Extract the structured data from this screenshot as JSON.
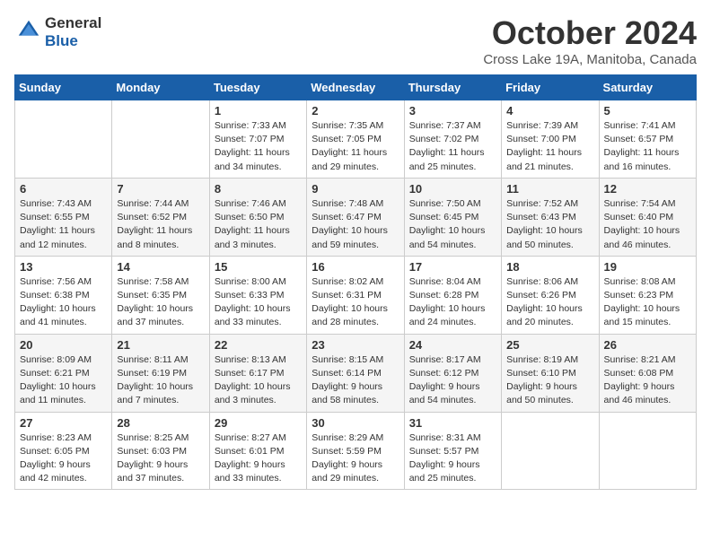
{
  "logo": {
    "general": "General",
    "blue": "Blue"
  },
  "header": {
    "month": "October 2024",
    "location": "Cross Lake 19A, Manitoba, Canada"
  },
  "weekdays": [
    "Sunday",
    "Monday",
    "Tuesday",
    "Wednesday",
    "Thursday",
    "Friday",
    "Saturday"
  ],
  "weeks": [
    [
      {
        "day": "",
        "info": ""
      },
      {
        "day": "",
        "info": ""
      },
      {
        "day": "1",
        "info": "Sunrise: 7:33 AM\nSunset: 7:07 PM\nDaylight: 11 hours\nand 34 minutes."
      },
      {
        "day": "2",
        "info": "Sunrise: 7:35 AM\nSunset: 7:05 PM\nDaylight: 11 hours\nand 29 minutes."
      },
      {
        "day": "3",
        "info": "Sunrise: 7:37 AM\nSunset: 7:02 PM\nDaylight: 11 hours\nand 25 minutes."
      },
      {
        "day": "4",
        "info": "Sunrise: 7:39 AM\nSunset: 7:00 PM\nDaylight: 11 hours\nand 21 minutes."
      },
      {
        "day": "5",
        "info": "Sunrise: 7:41 AM\nSunset: 6:57 PM\nDaylight: 11 hours\nand 16 minutes."
      }
    ],
    [
      {
        "day": "6",
        "info": "Sunrise: 7:43 AM\nSunset: 6:55 PM\nDaylight: 11 hours\nand 12 minutes."
      },
      {
        "day": "7",
        "info": "Sunrise: 7:44 AM\nSunset: 6:52 PM\nDaylight: 11 hours\nand 8 minutes."
      },
      {
        "day": "8",
        "info": "Sunrise: 7:46 AM\nSunset: 6:50 PM\nDaylight: 11 hours\nand 3 minutes."
      },
      {
        "day": "9",
        "info": "Sunrise: 7:48 AM\nSunset: 6:47 PM\nDaylight: 10 hours\nand 59 minutes."
      },
      {
        "day": "10",
        "info": "Sunrise: 7:50 AM\nSunset: 6:45 PM\nDaylight: 10 hours\nand 54 minutes."
      },
      {
        "day": "11",
        "info": "Sunrise: 7:52 AM\nSunset: 6:43 PM\nDaylight: 10 hours\nand 50 minutes."
      },
      {
        "day": "12",
        "info": "Sunrise: 7:54 AM\nSunset: 6:40 PM\nDaylight: 10 hours\nand 46 minutes."
      }
    ],
    [
      {
        "day": "13",
        "info": "Sunrise: 7:56 AM\nSunset: 6:38 PM\nDaylight: 10 hours\nand 41 minutes."
      },
      {
        "day": "14",
        "info": "Sunrise: 7:58 AM\nSunset: 6:35 PM\nDaylight: 10 hours\nand 37 minutes."
      },
      {
        "day": "15",
        "info": "Sunrise: 8:00 AM\nSunset: 6:33 PM\nDaylight: 10 hours\nand 33 minutes."
      },
      {
        "day": "16",
        "info": "Sunrise: 8:02 AM\nSunset: 6:31 PM\nDaylight: 10 hours\nand 28 minutes."
      },
      {
        "day": "17",
        "info": "Sunrise: 8:04 AM\nSunset: 6:28 PM\nDaylight: 10 hours\nand 24 minutes."
      },
      {
        "day": "18",
        "info": "Sunrise: 8:06 AM\nSunset: 6:26 PM\nDaylight: 10 hours\nand 20 minutes."
      },
      {
        "day": "19",
        "info": "Sunrise: 8:08 AM\nSunset: 6:23 PM\nDaylight: 10 hours\nand 15 minutes."
      }
    ],
    [
      {
        "day": "20",
        "info": "Sunrise: 8:09 AM\nSunset: 6:21 PM\nDaylight: 10 hours\nand 11 minutes."
      },
      {
        "day": "21",
        "info": "Sunrise: 8:11 AM\nSunset: 6:19 PM\nDaylight: 10 hours\nand 7 minutes."
      },
      {
        "day": "22",
        "info": "Sunrise: 8:13 AM\nSunset: 6:17 PM\nDaylight: 10 hours\nand 3 minutes."
      },
      {
        "day": "23",
        "info": "Sunrise: 8:15 AM\nSunset: 6:14 PM\nDaylight: 9 hours\nand 58 minutes."
      },
      {
        "day": "24",
        "info": "Sunrise: 8:17 AM\nSunset: 6:12 PM\nDaylight: 9 hours\nand 54 minutes."
      },
      {
        "day": "25",
        "info": "Sunrise: 8:19 AM\nSunset: 6:10 PM\nDaylight: 9 hours\nand 50 minutes."
      },
      {
        "day": "26",
        "info": "Sunrise: 8:21 AM\nSunset: 6:08 PM\nDaylight: 9 hours\nand 46 minutes."
      }
    ],
    [
      {
        "day": "27",
        "info": "Sunrise: 8:23 AM\nSunset: 6:05 PM\nDaylight: 9 hours\nand 42 minutes."
      },
      {
        "day": "28",
        "info": "Sunrise: 8:25 AM\nSunset: 6:03 PM\nDaylight: 9 hours\nand 37 minutes."
      },
      {
        "day": "29",
        "info": "Sunrise: 8:27 AM\nSunset: 6:01 PM\nDaylight: 9 hours\nand 33 minutes."
      },
      {
        "day": "30",
        "info": "Sunrise: 8:29 AM\nSunset: 5:59 PM\nDaylight: 9 hours\nand 29 minutes."
      },
      {
        "day": "31",
        "info": "Sunrise: 8:31 AM\nSunset: 5:57 PM\nDaylight: 9 hours\nand 25 minutes."
      },
      {
        "day": "",
        "info": ""
      },
      {
        "day": "",
        "info": ""
      }
    ]
  ]
}
